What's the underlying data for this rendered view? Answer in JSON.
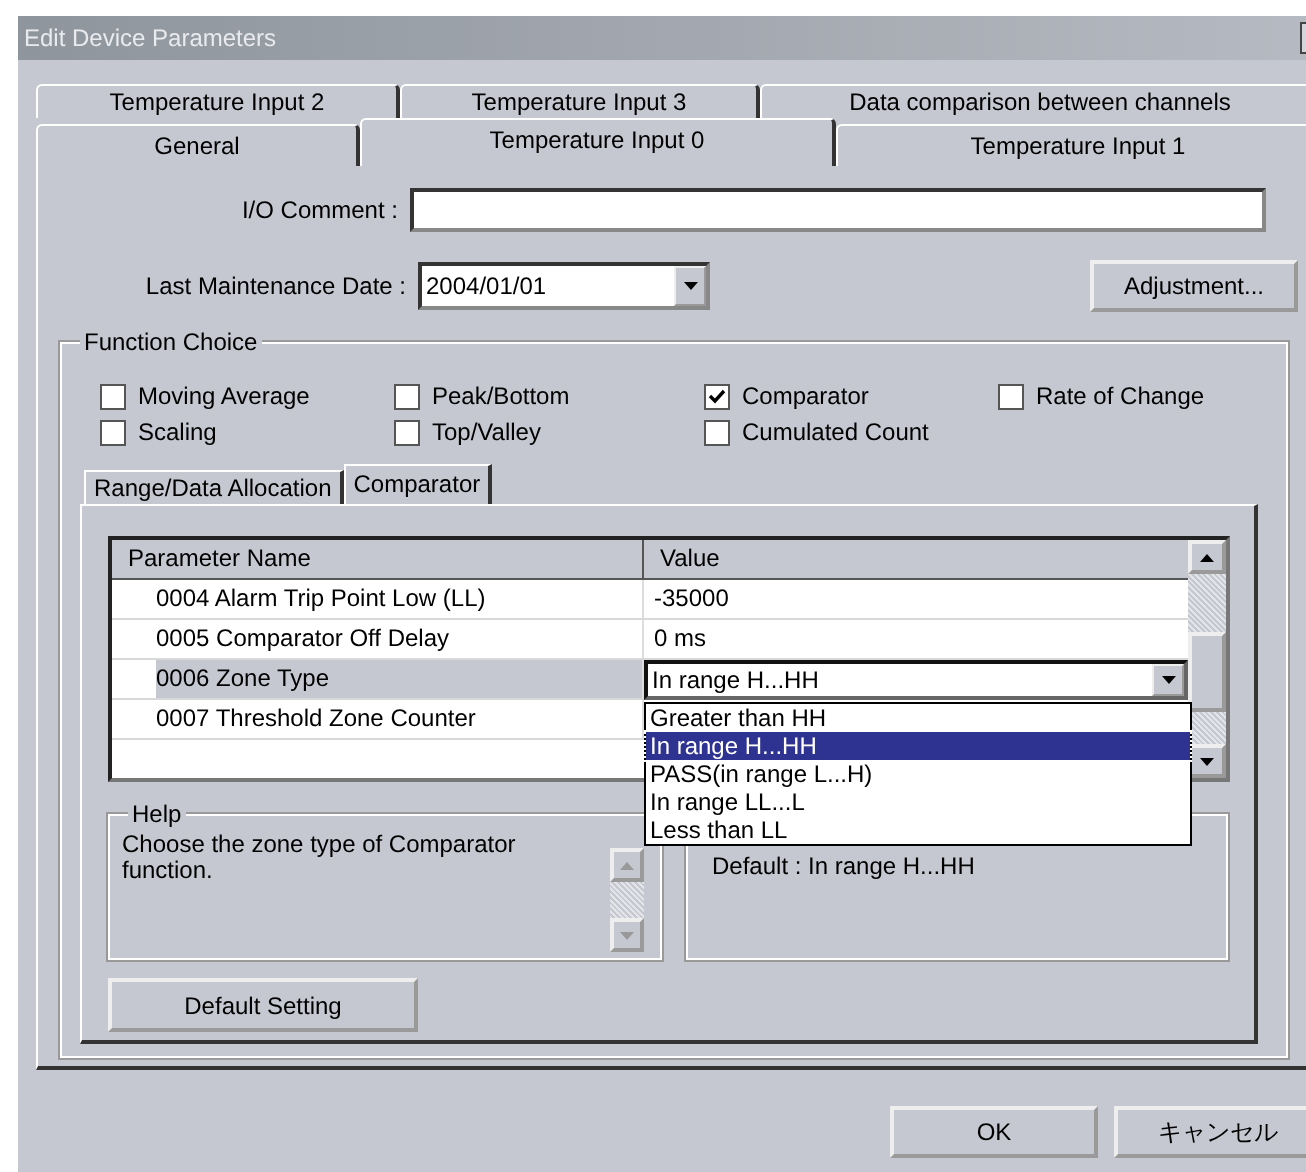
{
  "window": {
    "title": "Edit Device Parameters"
  },
  "tab_rows": [
    [
      {
        "label": "Temperature Input 2",
        "selected": false
      },
      {
        "label": "Temperature Input 3",
        "selected": false
      },
      {
        "label": "Data comparison between channels",
        "selected": false
      }
    ],
    [
      {
        "label": "General",
        "selected": false
      },
      {
        "label": "Temperature Input 0",
        "selected": true
      },
      {
        "label": "Temperature Input 1",
        "selected": false
      }
    ]
  ],
  "io_comment": {
    "label": "I/O Comment :"
  },
  "last_maintenance_date": {
    "label": "Last Maintenance Date :",
    "value": "2004/01/01"
  },
  "adjustment_button": "Adjustment...",
  "function_choice": {
    "title": "Function Choice",
    "options": [
      {
        "label": "Moving Average",
        "checked": false
      },
      {
        "label": "Peak/Bottom",
        "checked": false
      },
      {
        "label": "Comparator",
        "checked": true
      },
      {
        "label": "Rate of Change",
        "checked": false
      },
      {
        "label": "Scaling",
        "checked": false
      },
      {
        "label": "Top/Valley",
        "checked": false
      },
      {
        "label": "Cumulated Count",
        "checked": false
      }
    ]
  },
  "inner_tabs": [
    {
      "label": "Range/Data Allocation",
      "selected": false
    },
    {
      "label": "Comparator",
      "selected": true
    }
  ],
  "parameter_table": {
    "columns": [
      "Parameter Name",
      "Value"
    ],
    "rows": [
      {
        "name": "0004 Alarm Trip Point Low (LL)",
        "value": "-35000",
        "kind": "text",
        "selected": false
      },
      {
        "name": "0005 Comparator Off Delay",
        "value": "0 ms",
        "kind": "text",
        "selected": false
      },
      {
        "name": "0006 Zone Type",
        "value": "In range H...HH",
        "kind": "dropdown",
        "selected": true
      },
      {
        "name": "0007 Threshold Zone Counter",
        "kind": "text",
        "selected": false
      }
    ]
  },
  "dropdown_list": [
    {
      "label": "Greater than HH",
      "selected": false
    },
    {
      "label": "In range H...HH",
      "selected": true
    },
    {
      "label": "PASS(in range L...H)",
      "selected": false
    },
    {
      "label": "In range LL...L",
      "selected": false
    },
    {
      "label": "Less than LL",
      "selected": false
    }
  ],
  "help": {
    "title": "Help",
    "text": "Choose the zone type of Comparator function."
  },
  "default_info": "Default : In range H...HH",
  "default_setting_button": "Default Setting",
  "buttons": [
    "OK",
    "キャンセル"
  ]
}
